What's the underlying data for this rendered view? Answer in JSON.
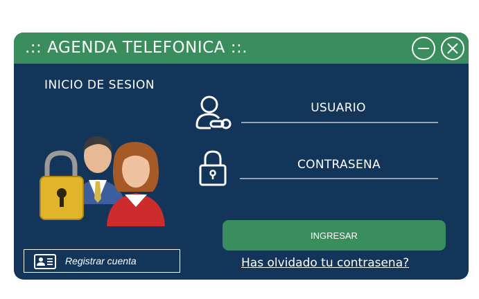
{
  "window": {
    "title": ".:: AGENDA TELEFONICA ::.",
    "minimize_icon": "minimize-icon",
    "close_icon": "close-icon"
  },
  "login": {
    "section_title": "INICIO DE SESION",
    "username_label": "USUARIO",
    "username_value": "",
    "password_label": "CONTRASENA",
    "password_value": "",
    "submit_label": "INGRESAR",
    "forgot_label": "Has olvidado tu contrasena?",
    "register_label": "Registrar cuenta"
  },
  "icons": {
    "illustration": "users-lock-illustration",
    "user": "user-key-icon",
    "password": "padlock-icon",
    "register": "id-card-icon"
  },
  "colors": {
    "window_bg": "#14355a",
    "titlebar": "#3a8d5c",
    "accent": "#3a8d5c",
    "text": "#ffffff"
  }
}
